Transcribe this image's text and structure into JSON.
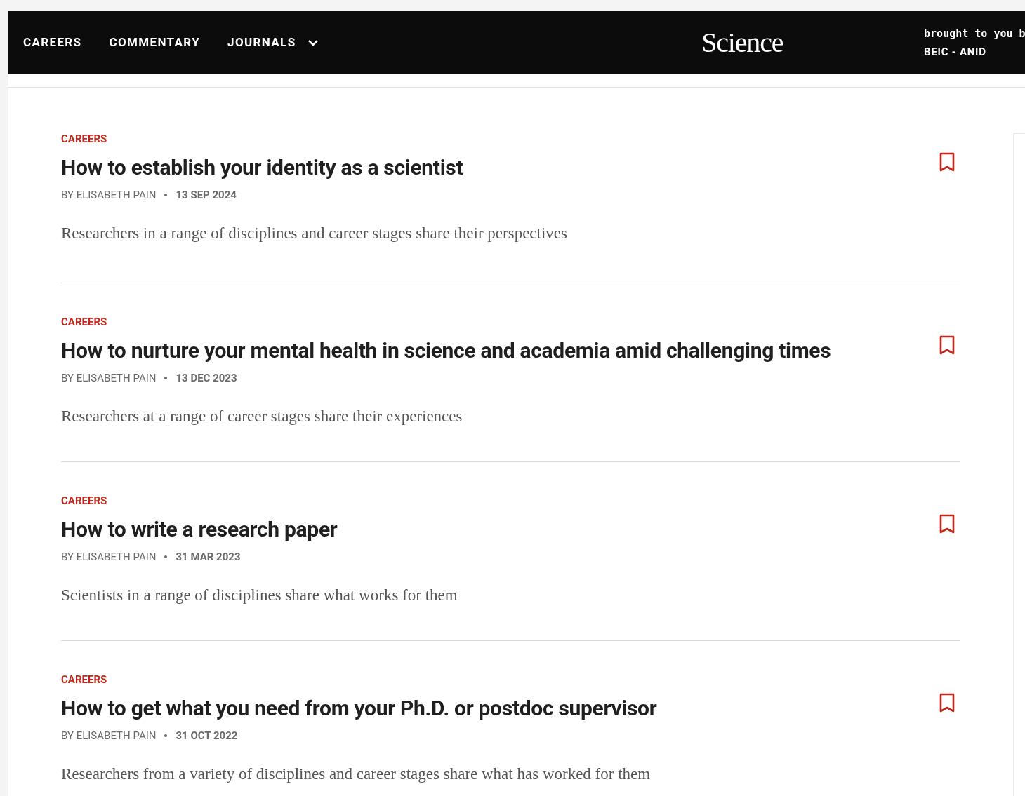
{
  "header": {
    "nav": [
      {
        "label": "CAREERS",
        "kind": "link"
      },
      {
        "label": "COMMENTARY",
        "kind": "link"
      },
      {
        "label": "JOURNALS",
        "kind": "dropdown"
      }
    ],
    "logo": "Science",
    "access": {
      "line_1": "brought to you b",
      "line_2": "BEIC - ANID"
    }
  },
  "articles": [
    {
      "category": "CAREERS",
      "title": "How to establish your identity as a scientist",
      "byline": "BY ELISABETH PAIN",
      "date": "13 SEP 2024",
      "summary": "Researchers in a range of disciplines and career stages share their perspectives"
    },
    {
      "category": "CAREERS",
      "title": "How to nurture your mental health in science and academia amid challenging times",
      "byline": "BY ELISABETH PAIN",
      "date": "13 DEC 2023",
      "summary": "Researchers at a range of career stages share their experiences"
    },
    {
      "category": "CAREERS",
      "title": "How to write a research paper",
      "byline": "BY ELISABETH PAIN",
      "date": "31 MAR 2023",
      "summary": "Scientists in a range of disciplines share what works for them"
    },
    {
      "category": "CAREERS",
      "title": "How to get what you need from your Ph.D. or postdoc supervisor",
      "byline": "BY ELISABETH PAIN",
      "date": "31 OCT 2022",
      "summary": "Researchers from a variety of disciplines and career stages share what has worked for them"
    }
  ]
}
